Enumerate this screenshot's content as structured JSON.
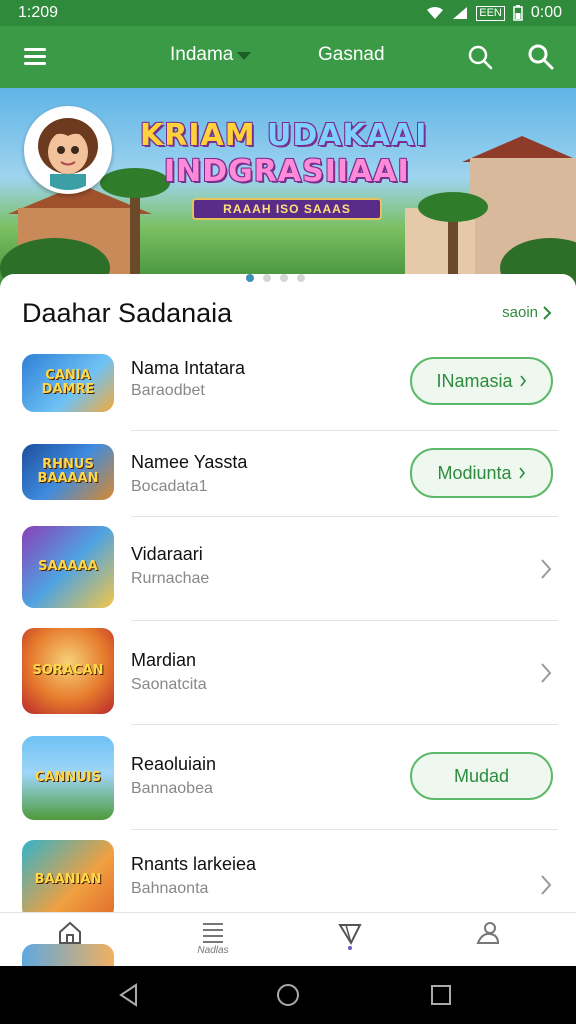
{
  "status_bar": {
    "time": "1:209",
    "battery_label": "EEN",
    "clock": "0:00"
  },
  "app_bar": {
    "dropdown_label": "Indama",
    "second_label": "Gasnad"
  },
  "banner": {
    "title_part_a": "KRIAM ",
    "title_part_b": "UDAKAAI",
    "title_line2": "INDGRASIIAAI",
    "ribbon_text": "RAAAH ISO SAAAS"
  },
  "section": {
    "title": "Daahar Sadanaia",
    "see_all": "saoin"
  },
  "items": [
    {
      "name": "Nama Intatara",
      "sub": "Baraodbet",
      "thumb_text": "CANIA DAMRE",
      "action": "INamasia",
      "has_chevron": true
    },
    {
      "name": "Namee Yassta",
      "sub": "Bocadata1",
      "thumb_text": "RHNUS BAAAAN",
      "action": "Modiunta",
      "has_chevron": true
    },
    {
      "name": "Vidaraari",
      "sub": "Rurnachae",
      "thumb_text": "SAAAAA",
      "action": "",
      "has_chevron": true
    },
    {
      "name": "Mardian",
      "sub": "Saonatcita",
      "thumb_text": "SORACAN",
      "action": "",
      "has_chevron": true
    },
    {
      "name": "Reaoluiain",
      "sub": "Bannaobea",
      "thumb_text": "CANNUIS",
      "action": "Mudad",
      "has_chevron": false
    },
    {
      "name": "Rnants larkeiea",
      "sub": "Bahnaonta",
      "thumb_text": "BAANIAN",
      "action": "",
      "has_chevron": true
    }
  ],
  "bottom_nav": {
    "list_label": "Nadlas"
  },
  "colors": {
    "app_bar": "#3a9a46",
    "status_bar": "#2f8a3c",
    "accent": "#2e8b3e",
    "action_bg": "#eef8ef"
  }
}
